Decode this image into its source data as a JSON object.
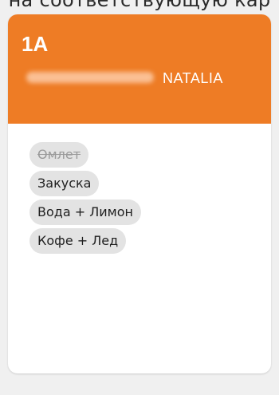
{
  "page": {
    "top_caption": "на соответствующую кар"
  },
  "card": {
    "seat": "1A",
    "passenger_first_name": "NATALIA",
    "header_color": "#ee7c25",
    "items": [
      {
        "label": "Омлет",
        "completed": true
      },
      {
        "label": "Закуска",
        "completed": false
      },
      {
        "label": "Вода + Лимон",
        "completed": false
      },
      {
        "label": "Кофе + Лед",
        "completed": false
      }
    ]
  }
}
